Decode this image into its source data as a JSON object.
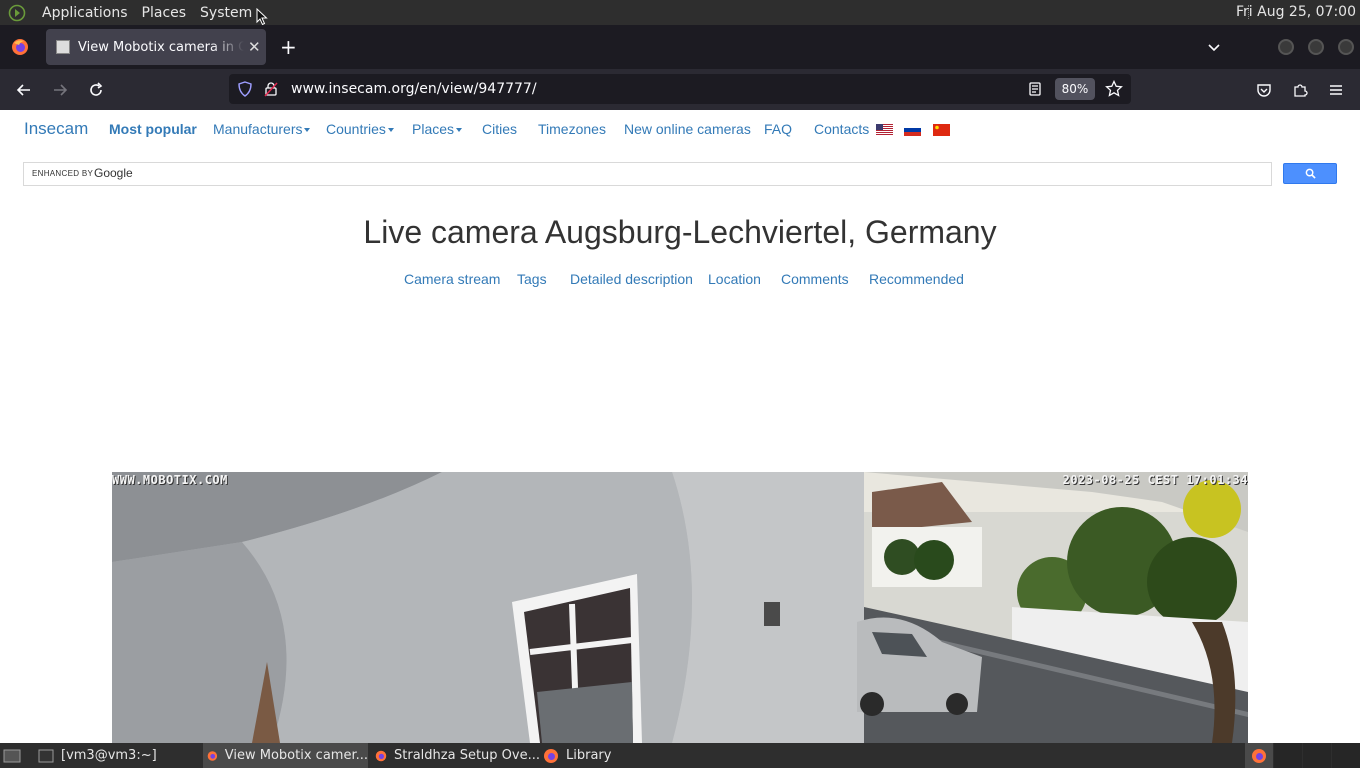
{
  "top_panel": {
    "menus": [
      "Applications",
      "Places",
      "System"
    ],
    "clock": "Fri Aug 25, 07:00"
  },
  "browser": {
    "active_tab_title": "View Mobotix camera in Germany",
    "url": "www.insecam.org/en/view/947777/",
    "zoom": "80%"
  },
  "site": {
    "brand": "Insecam",
    "nav": {
      "most_popular": "Most popular",
      "manufacturers": "Manufacturers",
      "countries": "Countries",
      "places": "Places",
      "cities": "Cities",
      "timezones": "Timezones",
      "new_online": "New online cameras",
      "faq": "FAQ",
      "contacts": "Contacts"
    },
    "flags": [
      "us-flag",
      "ru-flag",
      "cn-flag"
    ],
    "search": {
      "enhanced_by": "ENHANCED BY",
      "google": "Google"
    },
    "title": "Live camera Augsburg-Lechviertel, Germany",
    "sub_nav": [
      "Camera stream",
      "Tags",
      "Detailed description",
      "Location",
      "Comments",
      "Recommended"
    ],
    "camera": {
      "watermark": "WWW.MOBOTIX.COM",
      "timestamp": "2023-08-25 CEST 17:01:34"
    },
    "link_color": "#337ab7"
  },
  "taskbar": {
    "tasks": [
      "[vm3@vm3:~]",
      "View Mobotix camer...",
      "Straldhza Setup Ove...",
      "Library"
    ]
  }
}
